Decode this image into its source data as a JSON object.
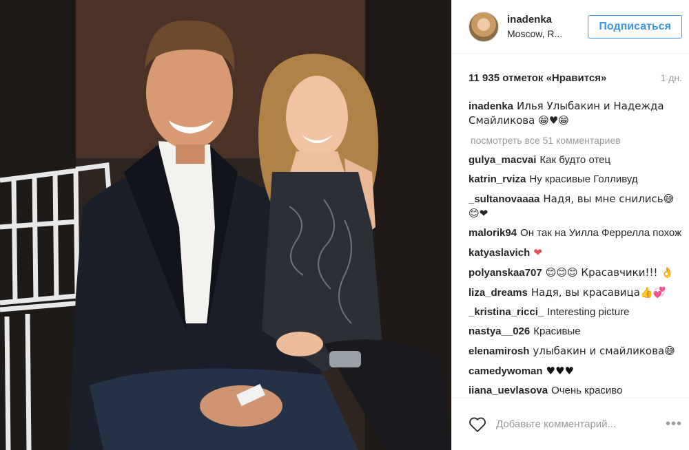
{
  "post": {
    "author": {
      "username": "inadenka",
      "location": "Moscow, R..."
    },
    "follow_label": "Подписаться",
    "likes_text": "11 935 отметок «Нравится»",
    "age": "1 дн.",
    "view_all_comments": "посмотреть все 51 комментариев",
    "comments": [
      {
        "user": "inadenka",
        "text": "Илья Улыбакин и Надежда Смайликова 😁♥😁"
      },
      {
        "user": "gulya_macvai",
        "text": "Как будто отец"
      },
      {
        "user": "katrin_rviza",
        "text": "Ну красивые Голливуд"
      },
      {
        "user": "_sultanovaaaa",
        "text": "Надя, вы мне снились😅😊❤"
      },
      {
        "user": "malorik94",
        "text": "Он так на Уилла Феррелла похож"
      },
      {
        "user": "katyaslavich",
        "text": "❤"
      },
      {
        "user": "polyanskaa707",
        "text": "😊😊😊 Красавчики!!! 👌"
      },
      {
        "user": "liza_dreams",
        "text": "Надя, вы красавица👍💞"
      },
      {
        "user": "_kristina_ricci_",
        "text": "Interesting picture"
      },
      {
        "user": "nastya__026",
        "text": "Красивые"
      },
      {
        "user": "elenamirosh",
        "text": "улыбакин и смайликова😅"
      },
      {
        "user": "camedywoman",
        "text": "♥♥♥"
      },
      {
        "user": "iiana_uevlasova",
        "text": "Очень красиво"
      }
    ],
    "comment_placeholder": "Добавьте комментарий...",
    "icons": {
      "like": "heart-outline-icon",
      "more": "more-options-icon"
    },
    "colors": {
      "accent": "#3897f0",
      "muted": "#999999",
      "text": "#262626",
      "heart": "#ed4956"
    }
  }
}
